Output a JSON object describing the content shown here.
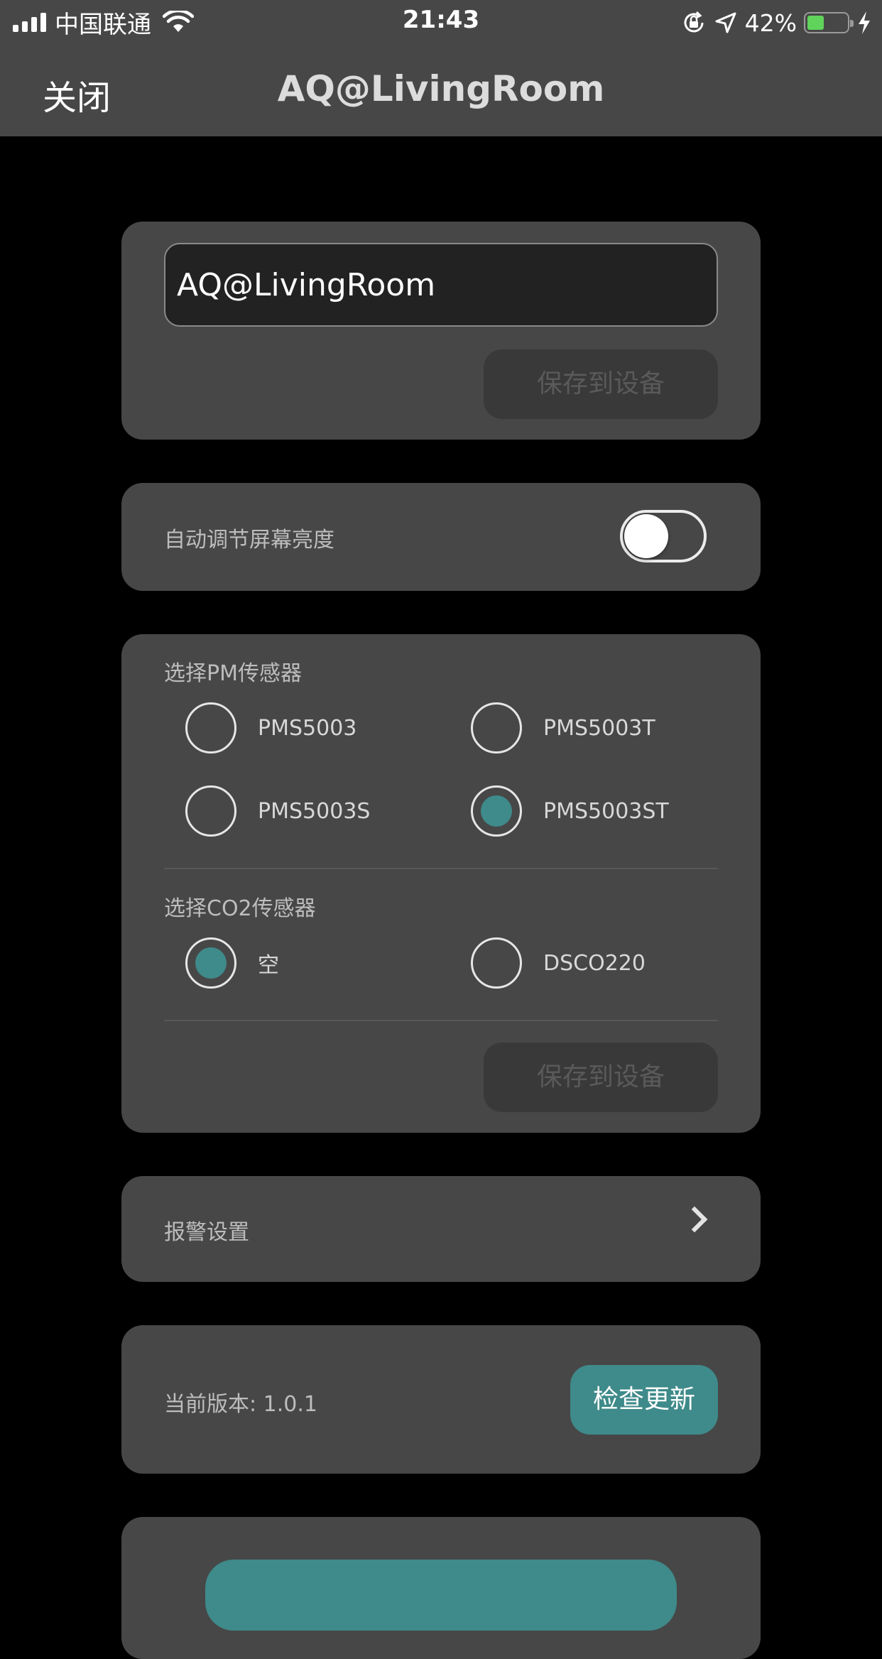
{
  "status_bar": {
    "carrier": "中国联通",
    "time": "21:43",
    "battery_percent": "42%",
    "battery_level": 0.42,
    "icons": [
      "signal-icon",
      "wifi-icon",
      "orientation-lock-icon",
      "location-icon",
      "battery-icon",
      "charging-icon"
    ]
  },
  "nav": {
    "close_label": "关闭",
    "title": "AQ@LivingRoom"
  },
  "device_name_card": {
    "input_value": "AQ@LivingRoom",
    "save_label": "保存到设备"
  },
  "brightness_card": {
    "label": "自动调节屏幕亮度",
    "toggle_on": false
  },
  "sensor_card": {
    "pm_title": "选择PM传感器",
    "pm_options": [
      "PMS5003",
      "PMS5003T",
      "PMS5003S",
      "PMS5003ST"
    ],
    "pm_selected": "PMS5003ST",
    "co2_title": "选择CO2传感器",
    "co2_options": [
      "空",
      "DSCO220"
    ],
    "co2_selected": "空",
    "save_label": "保存到设备"
  },
  "alarm_card": {
    "label": "报警设置"
  },
  "version_card": {
    "version_text": "当前版本: 1.0.1",
    "update_label": "检查更新"
  },
  "colors": {
    "accent": "#3f8a8a",
    "card": "#474747",
    "background": "#000000"
  }
}
